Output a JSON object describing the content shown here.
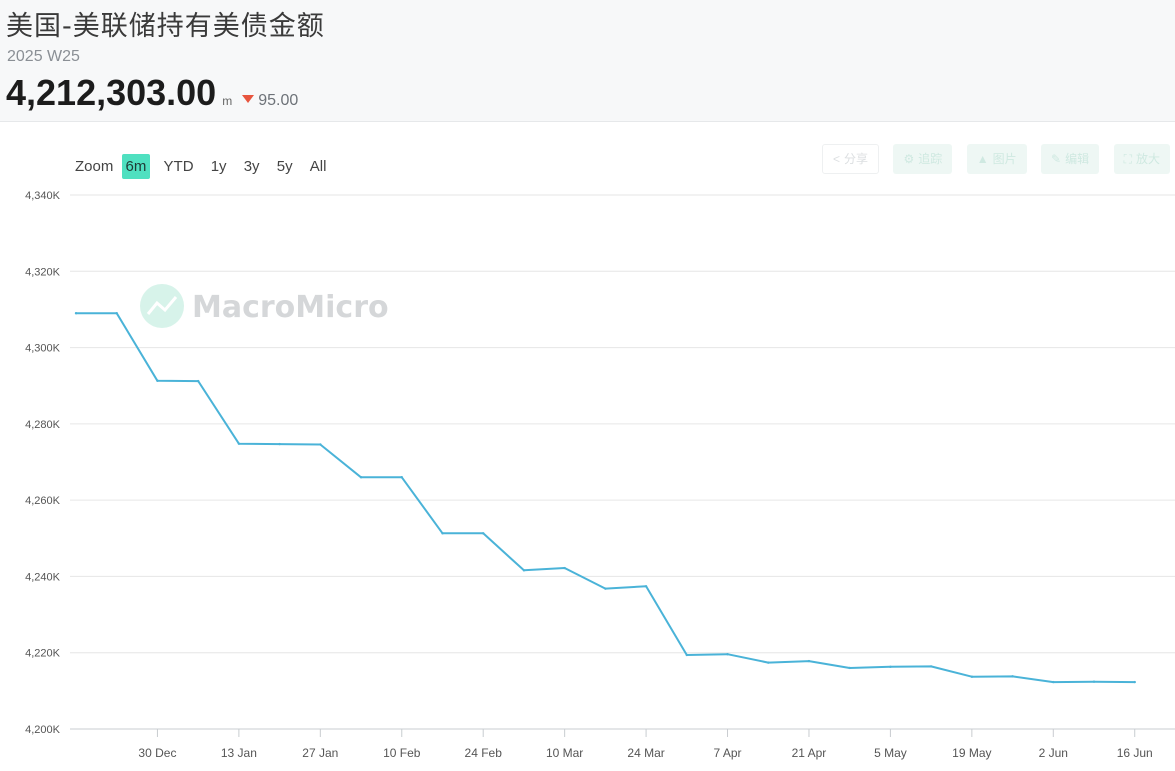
{
  "header": {
    "title": "美国-美联储持有美债金额",
    "period": "2025 W25",
    "value": "4,212,303.00",
    "unit": "m",
    "change": "95.00",
    "change_color": "#e8553e"
  },
  "zoom": {
    "label": "Zoom",
    "options": [
      "6m",
      "YTD",
      "1y",
      "3y",
      "5y",
      "All"
    ],
    "selected": "6m",
    "active_color": "#4fe0c0"
  },
  "toolbar": {
    "buttons": [
      {
        "label": "分享",
        "icon": "share-icon"
      },
      {
        "label": "追踪",
        "icon": "gear-icon"
      },
      {
        "label": "图片",
        "icon": "download-icon"
      },
      {
        "label": "编辑",
        "icon": "pencil-icon"
      },
      {
        "label": "放大",
        "icon": "expand-icon"
      }
    ]
  },
  "watermark": {
    "text": "MacroMicro"
  },
  "chart_data": {
    "type": "line",
    "title": "",
    "xlabel": "",
    "ylabel": "",
    "line_color": "#4ab3d8",
    "ylim": [
      4200000,
      4340000
    ],
    "ytick_values": [
      4200000,
      4220000,
      4240000,
      4260000,
      4280000,
      4300000,
      4320000,
      4340000
    ],
    "ytick_labels": [
      "4,200K",
      "4,220K",
      "4,240K",
      "4,260K",
      "4,280K",
      "4,300K",
      "4,320K",
      "4,340K"
    ],
    "xlim": [
      "2024-12-16",
      "2025-06-20"
    ],
    "xticks": [
      {
        "date": "2024-12-30",
        "label": "30 Dec"
      },
      {
        "date": "2025-01-13",
        "label": "13 Jan"
      },
      {
        "date": "2025-01-27",
        "label": "27 Jan"
      },
      {
        "date": "2025-02-10",
        "label": "10 Feb"
      },
      {
        "date": "2025-02-24",
        "label": "24 Feb"
      },
      {
        "date": "2025-03-10",
        "label": "10 Mar"
      },
      {
        "date": "2025-03-24",
        "label": "24 Mar"
      },
      {
        "date": "2025-04-07",
        "label": "7 Apr"
      },
      {
        "date": "2025-04-21",
        "label": "21 Apr"
      },
      {
        "date": "2025-05-05",
        "label": "5 May"
      },
      {
        "date": "2025-05-19",
        "label": "19 May"
      },
      {
        "date": "2025-06-02",
        "label": "2 Jun"
      },
      {
        "date": "2025-06-16",
        "label": "16 Jun"
      }
    ],
    "grid": true,
    "series": [
      {
        "x": [
          "2024-12-16",
          "2024-12-23",
          "2024-12-30",
          "2025-01-06",
          "2025-01-13",
          "2025-01-20",
          "2025-01-27",
          "2025-02-03",
          "2025-02-10",
          "2025-02-17",
          "2025-02-24",
          "2025-03-03",
          "2025-03-10",
          "2025-03-17",
          "2025-03-24",
          "2025-03-31",
          "2025-04-07",
          "2025-04-14",
          "2025-04-21",
          "2025-04-28",
          "2025-05-05",
          "2025-05-12",
          "2025-05-19",
          "2025-05-26",
          "2025-06-02",
          "2025-06-09",
          "2025-06-16"
        ],
        "values": [
          4309000,
          4309000,
          4291300,
          4291200,
          4274800,
          4274700,
          4274600,
          4266000,
          4266000,
          4251300,
          4251300,
          4241600,
          4242200,
          4236800,
          4237400,
          4219400,
          4219600,
          4217400,
          4217800,
          4216000,
          4216300,
          4216400,
          4213700,
          4213800,
          4212300,
          4212400,
          4212300
        ]
      }
    ]
  }
}
